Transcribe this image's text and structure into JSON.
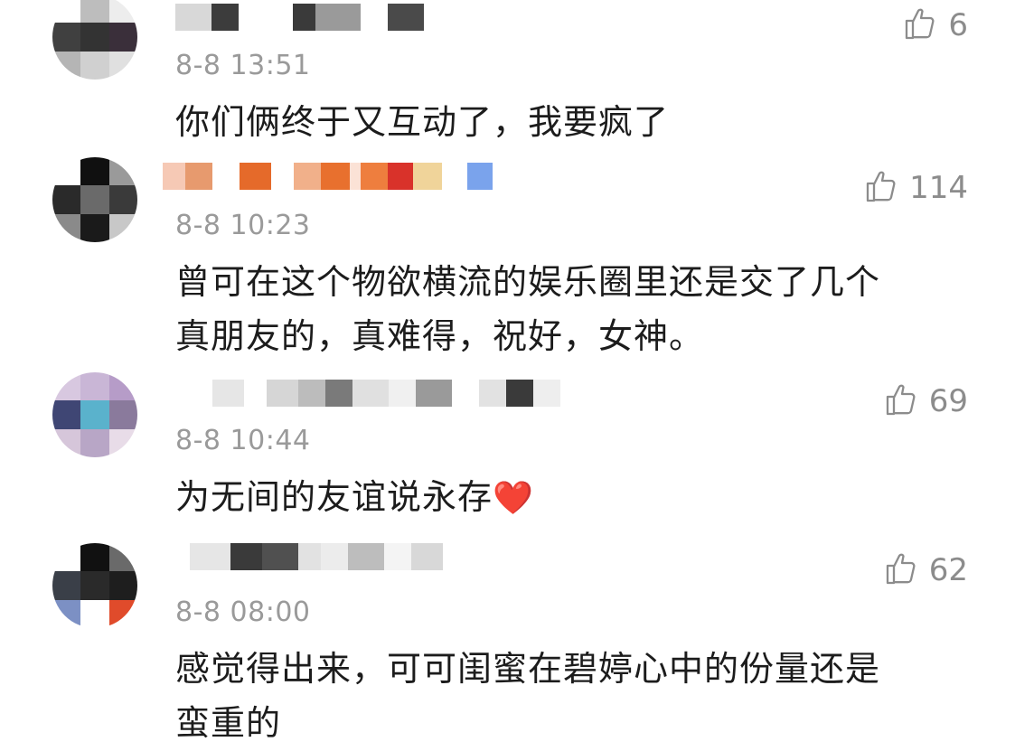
{
  "comments": [
    {
      "time": "8-8 13:51",
      "text": "你们俩终于又互动了，我要疯了",
      "likes": "6",
      "avatar_colors": [
        "#ffffff",
        "#bdbdbd",
        "#ededed",
        "#404040",
        "#333333",
        "#3a2f3a",
        "#b5b5b5",
        "#d0d0d0",
        "#e0e0e0"
      ],
      "name_colors": [
        "#d8d8d8",
        "#3c3c3c",
        "#ffffff",
        "#3a3a3a",
        "#9a9a9a",
        "#ffffff",
        "#4a4a4a"
      ]
    },
    {
      "time": "8-8 10:23",
      "text_lines": [
        "曾可在这个物欲横流的娱乐圈里还是交了几个",
        "真朋友的，真难得，祝好，女神。"
      ],
      "likes": "114",
      "avatar_colors": [
        "#ffffff",
        "#101010",
        "#9a9a9a",
        "#2a2a2a",
        "#6a6a6a",
        "#3a3a3a",
        "#8a8a8a",
        "#1a1a1a",
        "#c8c8c8"
      ],
      "name_colors": [
        "#f6c9b5",
        "#e79a6e",
        "#ffffff",
        "#e56a2a",
        "#ffffff",
        "#f1b08a",
        "#e8702e",
        "#fbe2d6",
        "#ee7e3e",
        "#d9322a",
        "#f0d49a",
        "#ffffff",
        "#7aa3ec"
      ]
    },
    {
      "time": "8-8 10:44",
      "text": "为无间的友谊说永存",
      "heart": "❤️",
      "likes": "69",
      "avatar_colors": [
        "#d8c8e0",
        "#c9b6d6",
        "#b69cc8",
        "#3f4674",
        "#5ab2cc",
        "#8a7a9c",
        "#d6c6da",
        "#b8a6c6",
        "#e8dce8"
      ],
      "name_colors": [
        "#ffffff",
        "#e6e6e6",
        "#ffffff",
        "#d6d6d6",
        "#bcbcbc",
        "#7a7a7a",
        "#e0e0e0",
        "#f0f0f0",
        "#9a9a9a",
        "#ffffff",
        "#e2e2e2",
        "#3a3a3a",
        "#eeeeee"
      ]
    },
    {
      "time": "8-8 08:00",
      "text_lines": [
        "感觉得出来，可可闺蜜在碧婷心中的份量还是",
        "蛮重的"
      ],
      "likes": "62",
      "avatar_colors": [
        "#ffffff",
        "#111111",
        "#6a6a6a",
        "#3a3f48",
        "#2a2a2a",
        "#1e1e1e",
        "#7c90c4",
        "#ffffff",
        "#e04b2b"
      ],
      "name_colors": [
        "#e6e6e6",
        "#3a3a3a",
        "#505050",
        "#e2e2e2",
        "#ececec",
        "#bdbdbd",
        "#f4f4f4",
        "#d8d8d8"
      ]
    }
  ],
  "icons": {
    "like": "thumbs-up-icon"
  }
}
